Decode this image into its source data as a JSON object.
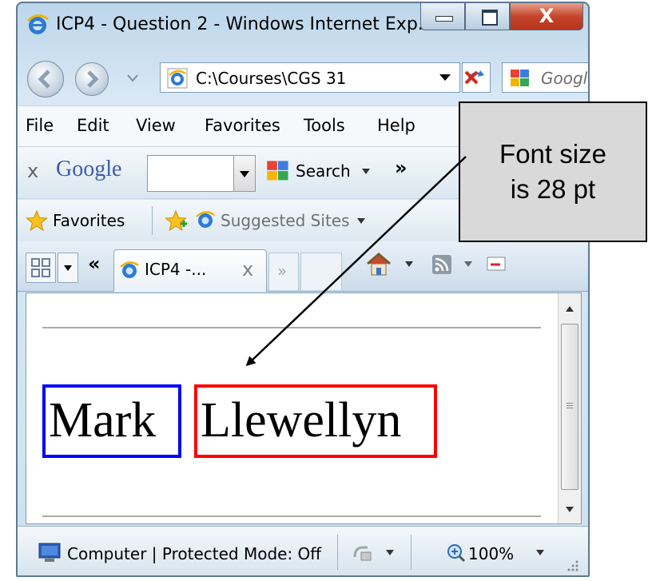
{
  "window": {
    "title": "ICP4 - Question 2 - Windows Internet Exp...",
    "minimize_glyph": "▭",
    "maximize_glyph": "▣",
    "close_glyph": "X"
  },
  "address_bar": {
    "value": "C:\\Courses\\CGS 31"
  },
  "search_box": {
    "placeholder": "Google"
  },
  "menu": {
    "items": [
      {
        "label": "File"
      },
      {
        "label": "Edit"
      },
      {
        "label": "View"
      },
      {
        "label": "Favorites"
      },
      {
        "label": "Tools"
      },
      {
        "label": "Help"
      }
    ]
  },
  "google_toolbar": {
    "close_glyph": "x",
    "brand": "Google",
    "search_label": "Search",
    "more_glyph": "»"
  },
  "favorites_bar": {
    "favorites_label": "Favorites",
    "suggested_label": "Suggested Sites"
  },
  "tabs": {
    "back_glyph": "«",
    "active_tab_label": "ICP4 -...",
    "tab_close_glyph": "x",
    "more_glyph": "»"
  },
  "page": {
    "first_name": "Mark",
    "last_name": "Llewellyn",
    "first_border_color": "#0000ff",
    "last_border_color": "#ff0000"
  },
  "status_bar": {
    "zone_text": "Computer | Protected Mode: Off",
    "zoom_text": "100%"
  },
  "callout": {
    "line1": "Font size",
    "line2": "is 28 pt"
  }
}
